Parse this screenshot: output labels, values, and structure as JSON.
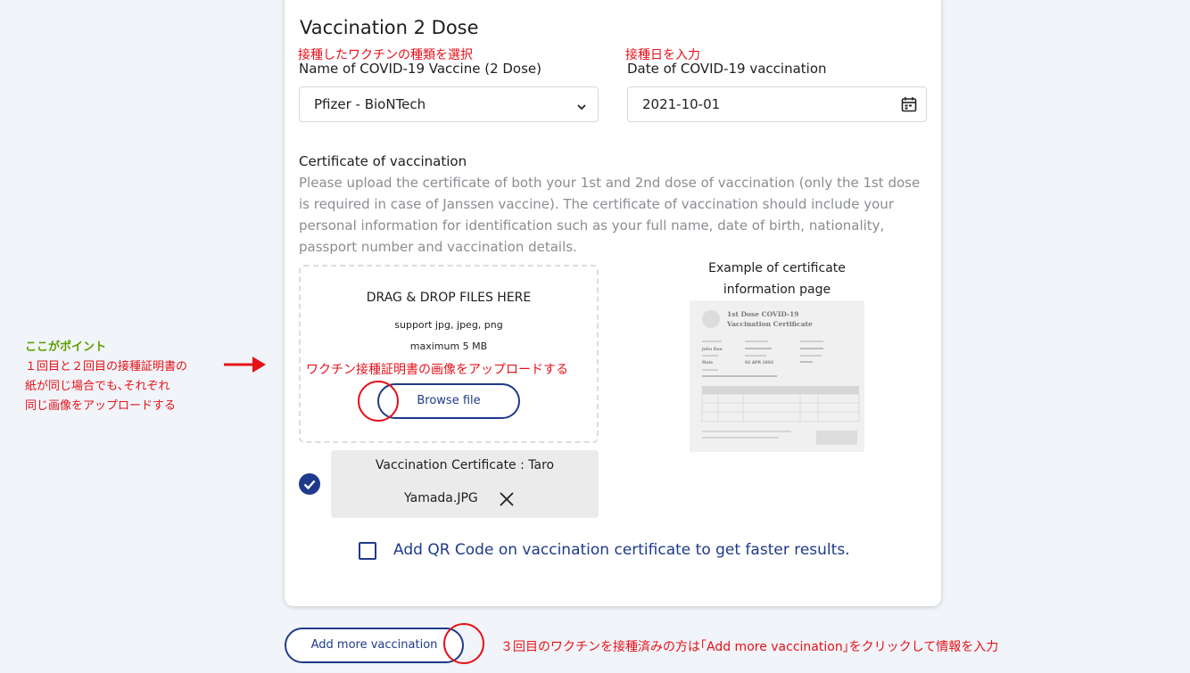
{
  "form": {
    "section_title": "Vaccination 2 Dose",
    "vaccine_name": {
      "annotation": "接種したワクチンの種類を選択",
      "label": "Name of COVID-19 Vaccine (2 Dose)",
      "value": "Pfizer - BioNTech"
    },
    "vaccination_date": {
      "annotation": "接種日を入力",
      "label": "Date of COVID-19 vaccination",
      "value": "2021-10-01"
    },
    "certificate": {
      "title": "Certificate of vaccination",
      "description": "Please upload the certificate of both your 1st and 2nd dose of vaccination (only the 1st dose is required in case of Janssen vaccine). The certificate of vaccination should include your personal information for identification such as your full name, date of birth, nationality, passport number and vaccination details."
    },
    "dropzone": {
      "title": "DRAG & DROP FILES HERE",
      "formats": "support jpg, jpeg, png",
      "max_size": "maximum 5 MB",
      "annotation": "ワクチン接種証明書の画像をアップロードする",
      "browse_label": "Browse file"
    },
    "example": {
      "title": "Example of certificate information page",
      "sample_title_line1": "1st Dose COVID-19",
      "sample_title_line2": "Vaccination Certificate",
      "sample_name": "John Doe",
      "sample_date": "02 APR 1992",
      "sample_gender": "Male"
    },
    "uploaded_file": {
      "name_line1": "Vaccination Certificate : Taro",
      "name_line2": "Yamada.JPG"
    },
    "qr_option": {
      "label": "Add QR Code on vaccination certificate to get faster results.",
      "checked": false
    },
    "add_more_label": "Add more vaccination"
  },
  "notes": {
    "left_heading": "ここがポイント",
    "left_lines": [
      "１回目と２回目の接種証明書の",
      "紙が同じ場合でも､それぞれ",
      "同じ画像をアップロードする"
    ],
    "bottom": "３回目のワクチンを接種済みの方は｢Add more vaccination｣をクリックして情報を入力"
  },
  "colors": {
    "primary": "#1e3a8a",
    "annotation_red": "#e6121b",
    "annotation_green": "#5c9e00",
    "page_bg": "#f1f4f8"
  },
  "icons": {
    "select_arrow": "chevron-down-icon",
    "date_picker": "calendar-icon",
    "uploaded_check": "check-circle-icon",
    "remove_file": "close-icon",
    "pointer_arrow": "arrow-right-icon"
  }
}
